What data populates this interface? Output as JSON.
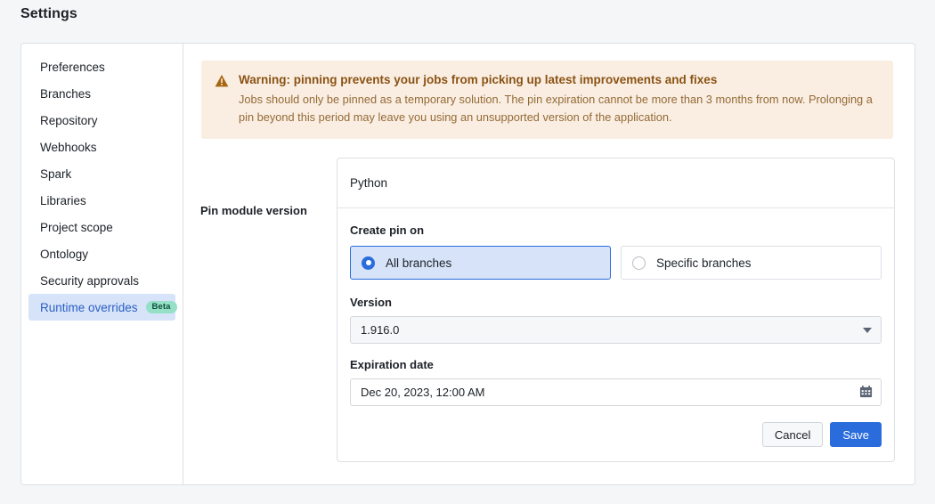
{
  "page": {
    "title": "Settings"
  },
  "sidebar": {
    "items": [
      {
        "label": "Preferences",
        "selected": false,
        "badge": null
      },
      {
        "label": "Branches",
        "selected": false,
        "badge": null
      },
      {
        "label": "Repository",
        "selected": false,
        "badge": null
      },
      {
        "label": "Webhooks",
        "selected": false,
        "badge": null
      },
      {
        "label": "Spark",
        "selected": false,
        "badge": null
      },
      {
        "label": "Libraries",
        "selected": false,
        "badge": null
      },
      {
        "label": "Project scope",
        "selected": false,
        "badge": null
      },
      {
        "label": "Ontology",
        "selected": false,
        "badge": null
      },
      {
        "label": "Security approvals",
        "selected": false,
        "badge": null
      },
      {
        "label": "Runtime overrides",
        "selected": true,
        "badge": "Beta"
      }
    ]
  },
  "warning": {
    "icon": "warning-triangle-icon",
    "title": "Warning: pinning prevents your jobs from picking up latest improvements and fixes",
    "body": "Jobs should only be pinned as a temporary solution. The pin expiration cannot be more than 3 months from now. Prolonging a pin beyond this period may leave you using an unsupported version of the application."
  },
  "form": {
    "section_label": "Pin module version",
    "module_name": "Python",
    "create_pin_on": {
      "label": "Create pin on",
      "options": [
        {
          "label": "All branches",
          "selected": true
        },
        {
          "label": "Specific branches",
          "selected": false
        }
      ]
    },
    "version": {
      "label": "Version",
      "value": "1.916.0"
    },
    "expiration": {
      "label": "Expiration date",
      "value": "Dec 20, 2023, 12:00 AM",
      "icon": "calendar-icon"
    },
    "actions": {
      "cancel": "Cancel",
      "save": "Save"
    }
  },
  "colors": {
    "accent": "#2b6cdc",
    "warning_bg": "#faeee3",
    "warning_text": "#8a5213",
    "selected_bg": "#d6e3f8",
    "badge_bg": "#96e0c8"
  }
}
